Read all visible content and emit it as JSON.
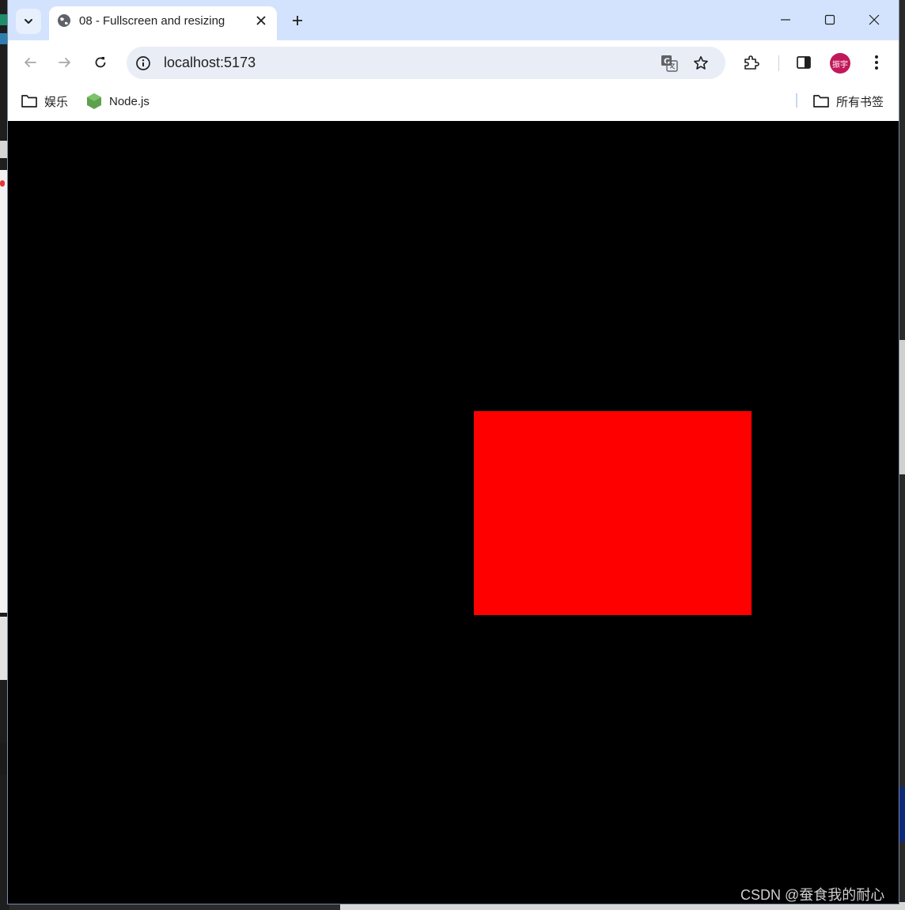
{
  "browser": {
    "tab": {
      "title": "08 - Fullscreen and resizing",
      "favicon": "globe-icon"
    },
    "omnibox": {
      "url": "localhost:5173"
    },
    "profile_avatar_text": "振宇",
    "bookmarks": [
      {
        "label": "娱乐",
        "icon": "folder-icon"
      },
      {
        "label": "Node.js",
        "icon": "nodejs-icon"
      }
    ],
    "all_bookmarks_label": "所有书签"
  },
  "page": {
    "background_color": "#000000",
    "mesh_color": "#ff0000"
  },
  "watermark": "CSDN @蚕食我的耐心"
}
